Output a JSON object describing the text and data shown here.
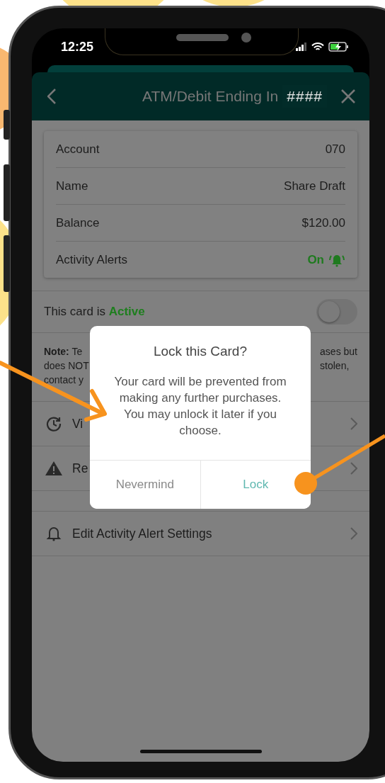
{
  "status_bar": {
    "time": "12:25"
  },
  "header": {
    "title": "ATM/Debit Ending In",
    "card_number": "####"
  },
  "account_details": [
    {
      "label": "Account",
      "value": "070",
      "kind": "text"
    },
    {
      "label": "Name",
      "value": "Share Draft",
      "kind": "text"
    },
    {
      "label": "Balance",
      "value": "$120.00",
      "kind": "text"
    },
    {
      "label": "Activity Alerts",
      "value": "On",
      "kind": "alert"
    }
  ],
  "card_status": {
    "label": "This card is",
    "status": "Active",
    "on": false
  },
  "note": {
    "left_lines": [
      "**Note:** Te",
      "does NOT",
      "contact y"
    ],
    "right_lines": [
      "ases but",
      "stolen,"
    ]
  },
  "menu_sections": [
    [
      {
        "label": "Vi",
        "kind": "history"
      },
      {
        "label": "Re",
        "kind": "warning"
      }
    ],
    [
      {
        "label": "Edit Activity Alert Settings",
        "kind": "bell"
      }
    ]
  ],
  "dialog": {
    "title": "Lock this Card?",
    "message": "Your card will be prevented from making any further purchases. You may unlock it later if you choose.",
    "buttons": [
      {
        "label": "Nevermind",
        "kind": "secondary"
      },
      {
        "label": "Lock",
        "kind": "primary"
      }
    ]
  }
}
